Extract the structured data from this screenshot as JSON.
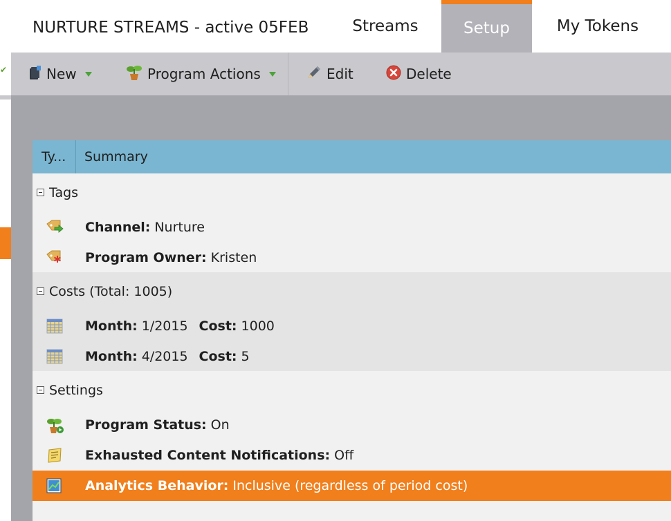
{
  "header": {
    "program_title": "NURTURE STREAMS - active 05FEB",
    "tabs": [
      "Streams",
      "Setup",
      "My Tokens"
    ],
    "active_tab": "Setup"
  },
  "toolbar": {
    "new_label": "New",
    "program_actions_label": "Program Actions",
    "edit_label": "Edit",
    "delete_label": "Delete"
  },
  "grid": {
    "col_type": "Ty...",
    "col_summary": "Summary"
  },
  "groups": {
    "tags": {
      "label": "Tags",
      "rows": [
        {
          "key": "Channel:",
          "value": "Nurture"
        },
        {
          "key": "Program Owner:",
          "value": "Kristen"
        }
      ]
    },
    "costs": {
      "label": "Costs (Total: 1005)",
      "rows": [
        {
          "k1": "Month:",
          "v1": "1/2015",
          "k2": "Cost:",
          "v2": "1000"
        },
        {
          "k1": "Month:",
          "v1": "4/2015",
          "k2": "Cost:",
          "v2": "5"
        }
      ]
    },
    "settings": {
      "label": "Settings",
      "rows": [
        {
          "key": "Program Status:",
          "value": "On"
        },
        {
          "key": "Exhausted Content Notifications:",
          "value": "Off"
        },
        {
          "key": "Analytics Behavior:",
          "value": "Inclusive (regardless of period cost)"
        }
      ]
    }
  },
  "colors": {
    "accent_orange": "#f07f1c",
    "grid_header_blue": "#7ab6d1",
    "toolbar_gray": "#c9c9cd",
    "content_gray": "#a4a4ab"
  },
  "icons": {
    "new": "new-program-icon",
    "program_actions": "plant-icon",
    "edit": "pencil-icon",
    "delete": "delete-x-icon",
    "channel": "tag-arrow-icon",
    "owner": "tag-asterisk-icon",
    "cost": "calendar-grid-icon",
    "status": "plant-play-icon",
    "notifications": "notepad-icon",
    "analytics": "analytics-chart-icon"
  }
}
